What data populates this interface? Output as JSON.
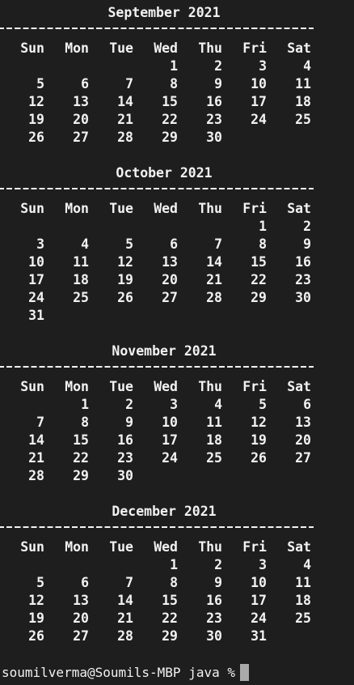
{
  "weekdays": [
    "Sun",
    "Mon",
    "Tue",
    "Wed",
    "Thu",
    "Fri",
    "Sat"
  ],
  "months": [
    {
      "title": "September 2021",
      "weeks": [
        [
          "",
          "",
          "",
          "1",
          "2",
          "3",
          "4"
        ],
        [
          "5",
          "6",
          "7",
          "8",
          "9",
          "10",
          "11"
        ],
        [
          "12",
          "13",
          "14",
          "15",
          "16",
          "17",
          "18"
        ],
        [
          "19",
          "20",
          "21",
          "22",
          "23",
          "24",
          "25"
        ],
        [
          "26",
          "27",
          "28",
          "29",
          "30",
          "",
          ""
        ]
      ]
    },
    {
      "title": "October 2021",
      "weeks": [
        [
          "",
          "",
          "",
          "",
          "",
          "1",
          "2"
        ],
        [
          "3",
          "4",
          "5",
          "6",
          "7",
          "8",
          "9"
        ],
        [
          "10",
          "11",
          "12",
          "13",
          "14",
          "15",
          "16"
        ],
        [
          "17",
          "18",
          "19",
          "20",
          "21",
          "22",
          "23"
        ],
        [
          "24",
          "25",
          "26",
          "27",
          "28",
          "29",
          "30"
        ],
        [
          "31",
          "",
          "",
          "",
          "",
          "",
          ""
        ]
      ]
    },
    {
      "title": "November 2021",
      "weeks": [
        [
          "",
          "1",
          "2",
          "3",
          "4",
          "5",
          "6"
        ],
        [
          "7",
          "8",
          "9",
          "10",
          "11",
          "12",
          "13"
        ],
        [
          "14",
          "15",
          "16",
          "17",
          "18",
          "19",
          "20"
        ],
        [
          "21",
          "22",
          "23",
          "24",
          "25",
          "26",
          "27"
        ],
        [
          "28",
          "29",
          "30",
          "",
          "",
          "",
          ""
        ]
      ]
    },
    {
      "title": "December 2021",
      "weeks": [
        [
          "",
          "",
          "",
          "1",
          "2",
          "3",
          "4"
        ],
        [
          "5",
          "6",
          "7",
          "8",
          "9",
          "10",
          "11"
        ],
        [
          "12",
          "13",
          "14",
          "15",
          "16",
          "17",
          "18"
        ],
        [
          "19",
          "20",
          "21",
          "22",
          "23",
          "24",
          "25"
        ],
        [
          "26",
          "27",
          "28",
          "29",
          "30",
          "31",
          ""
        ]
      ]
    }
  ],
  "prompt": {
    "text": "soumilverma@Soumils-MBP java %"
  },
  "colors": {
    "background": "#1e1e1e",
    "text": "#f2f2f2",
    "cursor": "#aaaaaa"
  }
}
